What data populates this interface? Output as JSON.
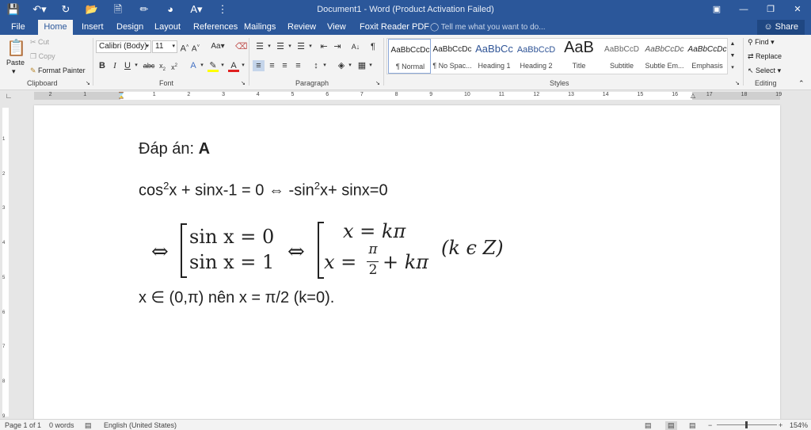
{
  "window": {
    "title": "Document1 - Word (Product Activation Failed)"
  },
  "qat": {
    "save_icon": "save-icon",
    "undo_icon": "undo-icon",
    "redo_icon": "redo-icon"
  },
  "tabs": [
    "File",
    "Home",
    "Insert",
    "Design",
    "Layout",
    "References",
    "Mailings",
    "Review",
    "View",
    "Foxit Reader PDF"
  ],
  "tell_me": "Tell me what you want to do...",
  "share": "Share",
  "clipboard": {
    "paste": "Paste",
    "cut": "Cut",
    "copy": "Copy",
    "format_painter": "Format Painter",
    "group": "Clipboard"
  },
  "font": {
    "name": "Calibri (Body)",
    "size": "11",
    "group": "Font"
  },
  "paragraph": {
    "group": "Paragraph"
  },
  "styles": {
    "group": "Styles",
    "items": [
      {
        "preview": "AaBbCcDc",
        "name": "¶ Normal"
      },
      {
        "preview": "AaBbCcDc",
        "name": "¶ No Spac..."
      },
      {
        "preview": "AaBbCc",
        "name": "Heading 1"
      },
      {
        "preview": "AaBbCcD",
        "name": "Heading 2"
      },
      {
        "preview": "AaB",
        "name": "Title"
      },
      {
        "preview": "AaBbCcD",
        "name": "Subtitle"
      },
      {
        "preview": "AaBbCcDc",
        "name": "Subtle Em..."
      },
      {
        "preview": "AaBbCcDc",
        "name": "Emphasis"
      }
    ]
  },
  "editing": {
    "group": "Editing",
    "find": "Find",
    "replace": "Replace",
    "select": "Select"
  },
  "ruler": {
    "numbers": [
      "2",
      "1",
      "1",
      "2",
      "3",
      "4",
      "5",
      "6",
      "7",
      "8",
      "9",
      "10",
      "11",
      "12",
      "13",
      "14",
      "15",
      "16",
      "17",
      "18",
      "19"
    ]
  },
  "vruler": {
    "numbers": [
      "1",
      "2",
      "3",
      "4",
      "5",
      "6",
      "7",
      "8",
      "9"
    ]
  },
  "document": {
    "answer_label": "Đáp án: ",
    "answer_value": "A",
    "line2_part1": "cos",
    "line2_sup1": "2",
    "line2_part2": "x + sinx-1 = 0 ⇔ -sin",
    "line2_sup2": "2",
    "line2_part3": "x+ sinx=0",
    "math": {
      "equiv": "⇔",
      "sys1_row1": "sin x = 0",
      "sys1_row2": "sin x = 1",
      "sys2_row1": "x = kπ",
      "sys2_row2_lhs": "x =",
      "frac_num": "π",
      "frac_den": "2",
      "sys2_row2_rhs": "+ kπ",
      "condition": "(k ϵ Z)"
    },
    "line3": "x ∈ (0,π) nên x = π/2 (k=0)."
  },
  "status": {
    "page": "Page 1 of 1",
    "words": "0 words",
    "language": "English (United States)",
    "zoom": "154%"
  }
}
